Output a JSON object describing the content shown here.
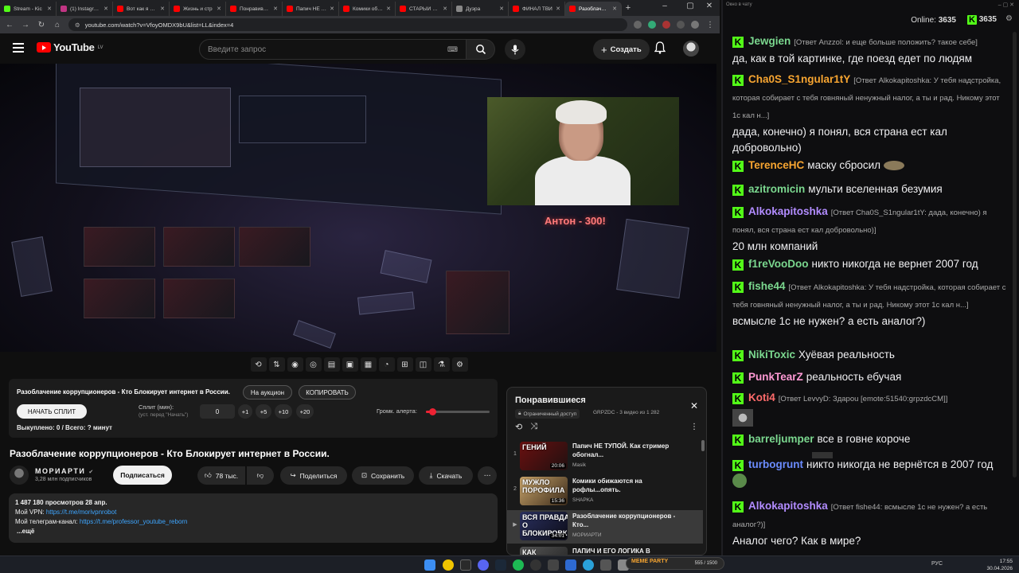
{
  "browser": {
    "tabs": [
      {
        "label": "Stream - Kic",
        "color": "#53fc18",
        "active": false
      },
      {
        "label": "(1) Instagram",
        "color": "#c13584",
        "active": false
      },
      {
        "label": "Вот как я Рос",
        "color": "#ff0000",
        "active": false
      },
      {
        "label": "Жизнь и стр",
        "color": "#ff0000",
        "active": false
      },
      {
        "label": "Понравивши",
        "color": "#ff0000",
        "active": false
      },
      {
        "label": "Папич НЕ ТУ",
        "color": "#ff0000",
        "active": false
      },
      {
        "label": "Комики обиж",
        "color": "#ff0000",
        "active": false
      },
      {
        "label": "СТАРЫЙ ЕСА",
        "color": "#ff0000",
        "active": false
      },
      {
        "label": "Дуэра",
        "color": "#888888",
        "active": false
      },
      {
        "label": "ФИНАЛ ТВИ",
        "color": "#ff0000",
        "active": false
      },
      {
        "label": "Разоблачени",
        "color": "#ff0000",
        "active": true
      }
    ],
    "url": "youtube.com/watch?v=VfoyOMDX9bU&list=LL&index=4"
  },
  "youtube": {
    "logo_text": "YouTube",
    "region": "LV",
    "search_placeholder": "Введите запрос",
    "create_label": "Создать"
  },
  "video": {
    "donation_text": "Антон - 300!"
  },
  "auction": {
    "title": "Разоблачение коррупционеров - Кто Блокирует интернет в России.",
    "on_auction_label": "На аукцион",
    "copy_label": "КОПИРОВАТЬ",
    "start_split_label": "НАЧАТЬ СПЛИТ",
    "split_label": "Сплит (мин):",
    "split_sub": "(уст. перед \"Начать\")",
    "split_value": "0",
    "increments": [
      "+1",
      "+5",
      "+10",
      "+20"
    ],
    "alert_label": "Громк. алерта:",
    "alert_level_percent": 10,
    "sold_text": "Выкуплено: 0 / Всего: ? минут"
  },
  "watch": {
    "title": "Разоблачение коррупционеров - Кто Блокирует интернет в России.",
    "channel": "МОРИАРТИ",
    "subscribers": "3,28 млн подписчиков",
    "subscribe_label": "Подписаться",
    "likes": "78 тыс.",
    "share_label": "Поделиться",
    "save_label": "Сохранить",
    "download_label": "Скачать",
    "views_date": "1 487 180 просмотров  28 апр.",
    "vpn_label": "Мой VPN:",
    "vpn_link": "https://t.me/morivpnrobot",
    "tg_label": "Мой телеграм-канал:",
    "tg_link": "https://t.me/professor_youtube_reborn",
    "more_label": "...ещё"
  },
  "playlist": {
    "title": "Понравившиеся",
    "limited_label": "Ограниченный доступ",
    "meta": "GRPZDC - 3 видео из 1 282",
    "items": [
      {
        "index": "1",
        "thumb_text": "ГЕНИЙ",
        "duration": "20:06",
        "title": "Папич НЕ ТУПОЙ. Как стример обогнал...",
        "channel": "Masik",
        "current": false
      },
      {
        "index": "2",
        "thumb_text": "МУЖЛО ПОРОФИЛА",
        "duration": "15:36",
        "title": "Комики обижаются на рофлы...опять.",
        "channel": "SHAPKA",
        "current": false
      },
      {
        "index": "▶",
        "thumb_text": "ВСЯ ПРАВДА О БЛОКИРОВКЕ",
        "duration": "34:01",
        "title": "Разоблачение коррупционеров - Кто...",
        "channel": "МОРИАРТИ",
        "current": true
      },
      {
        "index": "4",
        "thumb_text": "КАК",
        "duration": "",
        "title": "ПАПИЧ И ЕГО ЛОГИКА В",
        "channel": "",
        "current": false
      }
    ]
  },
  "chat": {
    "window_title": "Окно в чату",
    "online_label": "Online:",
    "online_count": "3635",
    "kick_count": "3635",
    "messages": [
      {
        "user": "Jewgien",
        "color": "#7bd88f",
        "reply": "[Ответ Anzzol: и еще больше положить? такое себе]",
        "text": "да, как в той картинке, где поезд едет по людям"
      },
      {
        "user": "Cha0S_S1ngular1tY",
        "color": "#f7a531",
        "reply": "[Ответ Alkokapitoshka: У тебя надстройка, которая собирает с тебя говняный ненужный налог, а ты и рад. Никому этот 1с кал н...]",
        "text": "дада, конечно) я понял, вся страна ест кал добровольно)"
      },
      {
        "user": "TerenceHC",
        "color": "#f7a531",
        "reply": "",
        "text": "маску сбросил"
      },
      {
        "user": "azitromicin",
        "color": "#7bd88f",
        "reply": "",
        "text": "мульти вселенная безумия"
      },
      {
        "user": "Alkokapitoshka",
        "color": "#b28cff",
        "reply": "[Ответ Cha0S_S1ngular1tY: дада, конечно) я понял, вся страна ест кал добровольно)]",
        "text": "20 млн компаний"
      },
      {
        "user": "f1reVooDoo",
        "color": "#7bd88f",
        "reply": "",
        "text": "никто никогда не вернет 2007 год"
      },
      {
        "user": "fishe44",
        "color": "#7bd88f",
        "reply": "[Ответ Alkokapitoshka: У тебя надстройка, которая собирает с тебя говняный ненужный налог, а ты и рад. Никому этот 1с кал н...]",
        "text": "всмысле 1с не нужен? а есть аналог?)"
      },
      {
        "user": "NikiToxic",
        "color": "#7bd88f",
        "reply": "",
        "text": "Хуёвая реальность"
      },
      {
        "user": "PunkTearZ",
        "color": "#ff9ad5",
        "reply": "",
        "text": "реальность ебучая"
      },
      {
        "user": "Koti4",
        "color": "#ff6b6b",
        "reply": "[Ответ LevvyD: Здарou [emote:51540:grpzdcCM]]",
        "text": ""
      },
      {
        "user": "barreljumper",
        "color": "#7bd88f",
        "reply": "",
        "text": "все в говне короче"
      },
      {
        "user": "turbogrunt",
        "color": "#6b8cff",
        "reply": "",
        "text": "никто никогда не вернётся в 2007 год"
      },
      {
        "user": "Alkokapitoshka",
        "color": "#b28cff",
        "reply": "[Ответ fishe44: всмысле 1с не нужен? а есть аналог?)]",
        "text": "Аналог чего? Как в мире?"
      }
    ]
  },
  "taskbar": {
    "meme_label": "MEME PARTY",
    "meme_progress": "555 / 1500",
    "lang": "РУС",
    "time": "17:55",
    "date": "30.04.2026"
  }
}
